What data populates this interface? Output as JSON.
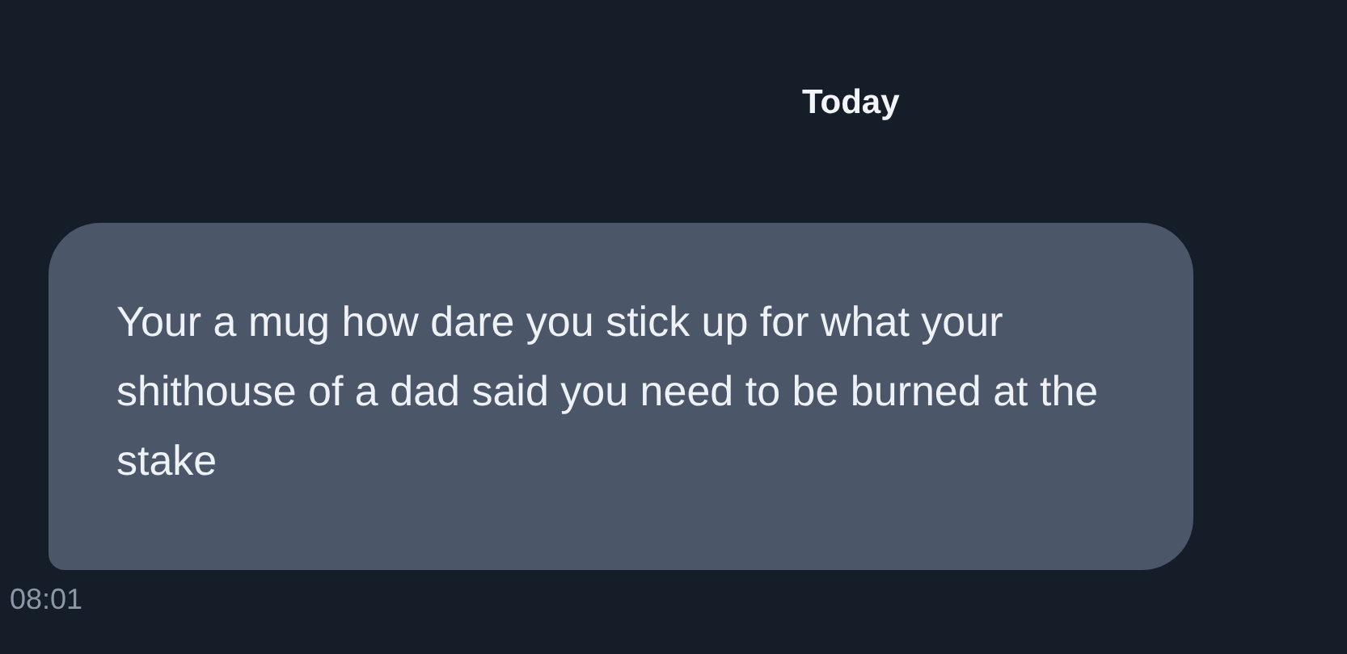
{
  "date_divider": "Today",
  "messages": [
    {
      "text": "Your a mug how dare you stick up for what your shithouse of a dad said you need to be burned at the stake",
      "time": "08:01"
    }
  ]
}
